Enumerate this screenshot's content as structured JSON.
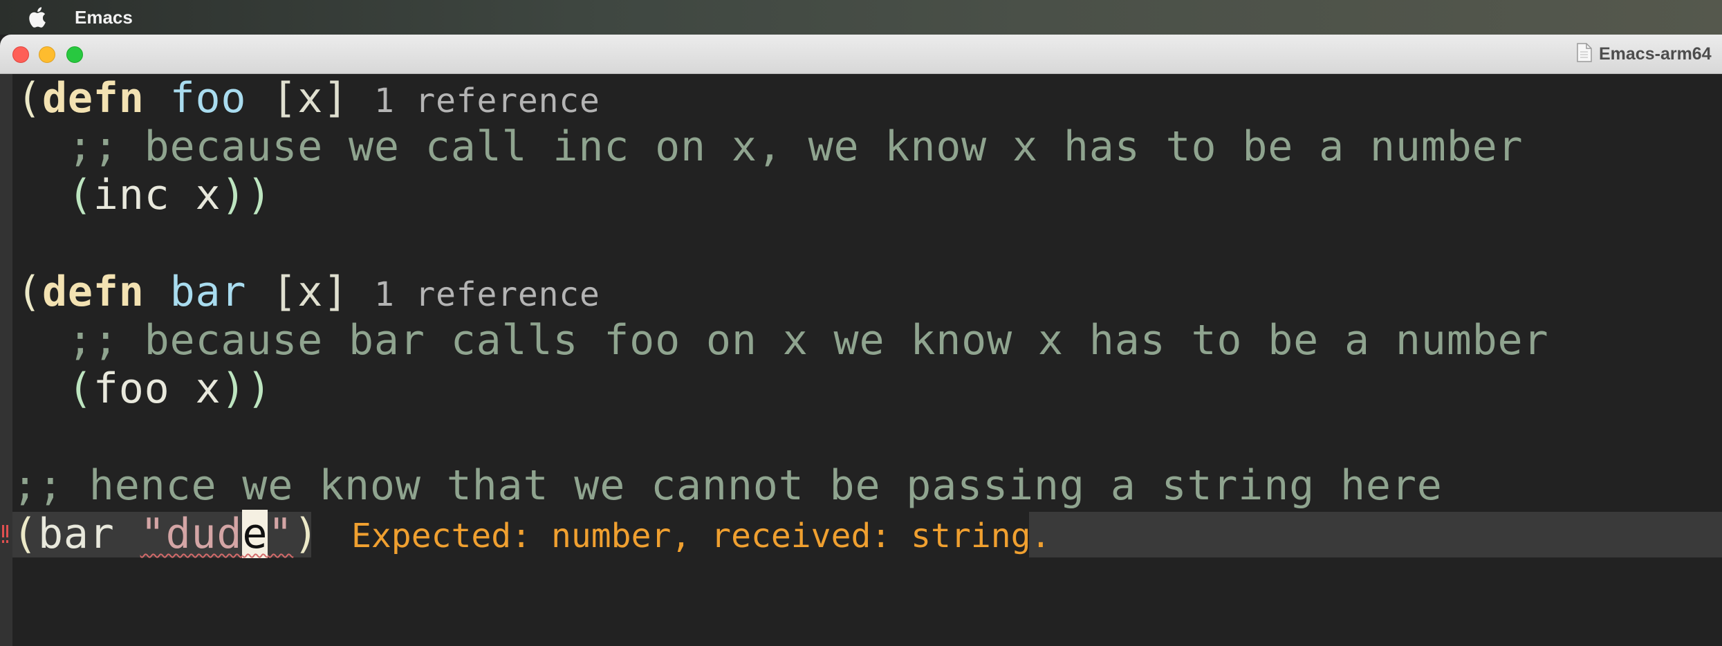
{
  "menubar": {
    "app_name": "Emacs",
    "apple_icon": "apple-logo-icon"
  },
  "window": {
    "title": "Emacs-arm64",
    "file_icon": "document-icon"
  },
  "colors": {
    "keyword": "#f3e2b2",
    "function_name": "#a9dcef",
    "comment": "#8fa48f",
    "string": "#d4a5a5",
    "error": "#f0a030",
    "background": "#222222"
  },
  "code": {
    "line1": {
      "open": "(",
      "kw": "defn",
      "name": "foo",
      "args": "[x]",
      "ref": "1 reference"
    },
    "line2": {
      "comment": ";; because we call inc on x, we know x has to be a number"
    },
    "line3": {
      "open": "(",
      "body": "inc x",
      "close": "))"
    },
    "line5": {
      "open": "(",
      "kw": "defn",
      "name": "bar",
      "args": "[x]",
      "ref": "1 reference"
    },
    "line6": {
      "comment": ";; because bar calls foo on x we know x has to be a number"
    },
    "line7": {
      "open": "(",
      "body": "foo x",
      "close": "))"
    },
    "line9": {
      "comment": ";; hence we know that we cannot be passing a string here"
    },
    "line10": {
      "open": "(",
      "fn": "bar",
      "str_a": "\"dud",
      "cursor_char": "e",
      "str_b": "\"",
      "close": ")"
    }
  },
  "diagnostic": {
    "message": "Expected: number, received: string."
  }
}
